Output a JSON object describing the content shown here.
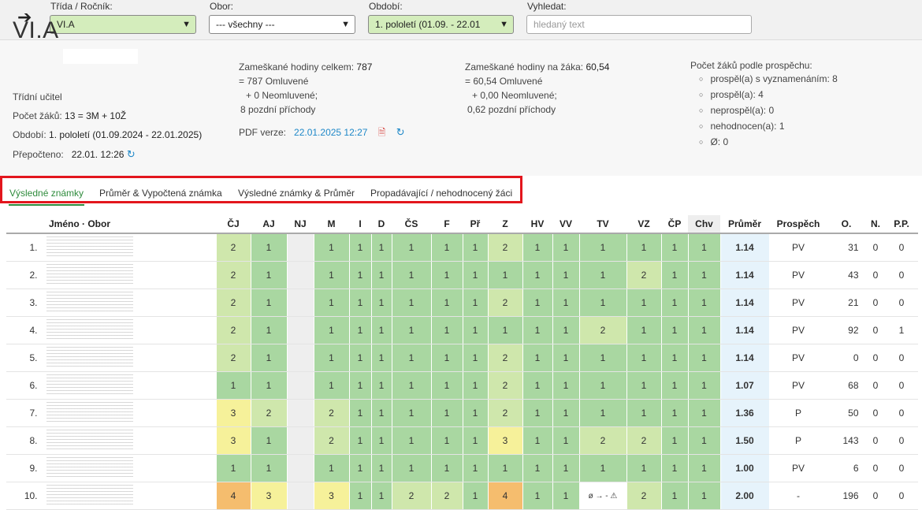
{
  "filters": {
    "class_label": "Třída / Ročník:",
    "class_value": "VI.A",
    "field_label": "Obor:",
    "field_value": "--- všechny ---",
    "period_label": "Období:",
    "period_value": "1. pololetí (01.09. - 22.01",
    "search_label": "Vyhledat:",
    "search_placeholder": "hledaný text"
  },
  "summary": {
    "class_name": "VI.A",
    "teacher_label": "Třídní učitel",
    "students_label": "Počet žáků:",
    "students_value": "13 = 3M + 10Ž",
    "period_label": "Období:",
    "period_value": "1. pololetí (01.09.2024 - 22.01.2025)",
    "recalc_label": "Přepočteno:",
    "recalc_value": "22.01. 12:26",
    "absence_total_label": "Zameškané hodiny celkem:",
    "absence_total_value": "787",
    "absence_total_excused": "= 787 Omluvené",
    "absence_total_unexcused": "+ 0 Neomluvené;",
    "absence_total_late": "8 pozdní příchody",
    "pdf_label": "PDF verze:",
    "pdf_value": "22.01.2025 12:27",
    "absence_per_label": "Zameškané hodiny na žáka:",
    "absence_per_value": "60,54",
    "absence_per_excused": "= 60,54 Omluvené",
    "absence_per_unexcused": "+ 0,00 Neomluvené;",
    "absence_per_late": "0,62 pozdní příchody",
    "results_label": "Počet žáků podle prospěchu:",
    "results": [
      "prospěl(a) s vyznamenáním: 8",
      "prospěl(a): 4",
      "neprospěl(a): 0",
      "nehodnocen(a): 1",
      "Ø: 0"
    ]
  },
  "tabs": [
    "Výsledné známky",
    "Průměr & Vypočtená známka",
    "Výsledné známky & Průměr",
    "Propadávající / nehodnocený žáci"
  ],
  "table": {
    "name_header": "Jméno · Obor",
    "subjects": [
      "ČJ",
      "AJ",
      "NJ",
      "M",
      "I",
      "D",
      "ČS",
      "F",
      "Př",
      "Z",
      "HV",
      "VV",
      "TV",
      "VZ",
      "ČP",
      "Chv"
    ],
    "extra_headers": [
      "Průměr",
      "Prospěch",
      "O.",
      "N.",
      "P.P."
    ],
    "rows": [
      {
        "num": "1.",
        "grades": [
          "2",
          "1",
          "",
          "1",
          "1",
          "1",
          "1",
          "1",
          "1",
          "2",
          "1",
          "1",
          "1",
          "1",
          "1",
          "1"
        ],
        "avg": "1.14",
        "result": "PV",
        "o": "31",
        "n": "0",
        "pp": "0"
      },
      {
        "num": "2.",
        "grades": [
          "2",
          "1",
          "",
          "1",
          "1",
          "1",
          "1",
          "1",
          "1",
          "1",
          "1",
          "1",
          "1",
          "2",
          "1",
          "1"
        ],
        "avg": "1.14",
        "result": "PV",
        "o": "43",
        "n": "0",
        "pp": "0"
      },
      {
        "num": "3.",
        "grades": [
          "2",
          "1",
          "",
          "1",
          "1",
          "1",
          "1",
          "1",
          "1",
          "2",
          "1",
          "1",
          "1",
          "1",
          "1",
          "1"
        ],
        "avg": "1.14",
        "result": "PV",
        "o": "21",
        "n": "0",
        "pp": "0"
      },
      {
        "num": "4.",
        "grades": [
          "2",
          "1",
          "",
          "1",
          "1",
          "1",
          "1",
          "1",
          "1",
          "1",
          "1",
          "1",
          "2",
          "1",
          "1",
          "1"
        ],
        "avg": "1.14",
        "result": "PV",
        "o": "92",
        "n": "0",
        "pp": "1"
      },
      {
        "num": "5.",
        "grades": [
          "2",
          "1",
          "",
          "1",
          "1",
          "1",
          "1",
          "1",
          "1",
          "2",
          "1",
          "1",
          "1",
          "1",
          "1",
          "1"
        ],
        "avg": "1.14",
        "result": "PV",
        "o": "0",
        "n": "0",
        "pp": "0"
      },
      {
        "num": "6.",
        "grades": [
          "1",
          "1",
          "",
          "1",
          "1",
          "1",
          "1",
          "1",
          "1",
          "2",
          "1",
          "1",
          "1",
          "1",
          "1",
          "1"
        ],
        "avg": "1.07",
        "result": "PV",
        "o": "68",
        "n": "0",
        "pp": "0"
      },
      {
        "num": "7.",
        "grades": [
          "3",
          "2",
          "",
          "2",
          "1",
          "1",
          "1",
          "1",
          "1",
          "2",
          "1",
          "1",
          "1",
          "1",
          "1",
          "1"
        ],
        "avg": "1.36",
        "result": "P",
        "o": "50",
        "n": "0",
        "pp": "0"
      },
      {
        "num": "8.",
        "grades": [
          "3",
          "1",
          "",
          "2",
          "1",
          "1",
          "1",
          "1",
          "1",
          "3",
          "1",
          "1",
          "2",
          "2",
          "1",
          "1"
        ],
        "avg": "1.50",
        "result": "P",
        "o": "143",
        "n": "0",
        "pp": "0"
      },
      {
        "num": "9.",
        "grades": [
          "1",
          "1",
          "",
          "1",
          "1",
          "1",
          "1",
          "1",
          "1",
          "1",
          "1",
          "1",
          "1",
          "1",
          "1",
          "1"
        ],
        "avg": "1.00",
        "result": "PV",
        "o": "6",
        "n": "0",
        "pp": "0"
      },
      {
        "num": "10.",
        "grades": [
          "4",
          "3",
          "",
          "3",
          "1",
          "1",
          "2",
          "2",
          "1",
          "4",
          "1",
          "1",
          "ø → - ⚠",
          "2",
          "1",
          "1"
        ],
        "avg": "2.00",
        "result": "-",
        "o": "196",
        "n": "0",
        "pp": "0"
      }
    ]
  },
  "colors": {
    "grade_1": "#a9d7a1",
    "grade_2": "#cfe7ac",
    "grade_3": "#f6f19a",
    "grade_4": "#f5bd6e",
    "average_bg": "#e6f3fb",
    "tab_active": "#2e8b3c",
    "highlight_border": "#e3161d"
  }
}
